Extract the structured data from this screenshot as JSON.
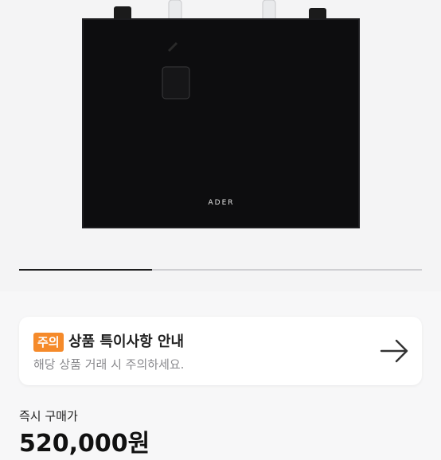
{
  "product": {
    "brand_logo": "ADER",
    "image_count_progress": 0.33
  },
  "notice": {
    "badge": "주의",
    "title": "상품 특이사항 안내",
    "subtitle": "해당 상품 거래 시 주의하세요.",
    "arrow_icon": "arrow-right-icon",
    "badge_color": "#f58a2a"
  },
  "purchase": {
    "label": "즉시 구매가",
    "price": "520,000원"
  }
}
